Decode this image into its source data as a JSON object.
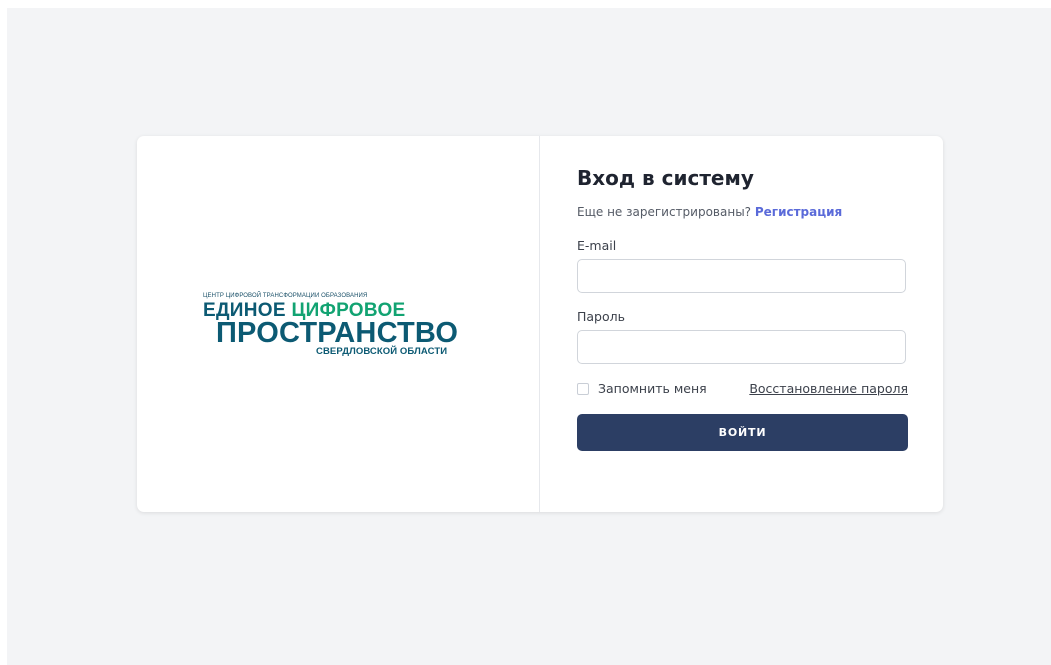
{
  "logo": {
    "top_text": "ЦЕНТР ЦИФРОВОЙ ТРАНСФОРМАЦИИ ОБРАЗОВАНИЯ",
    "line1_dark": "ЕДИНОЕ",
    "line1_green": "ЦИФРОВОЕ",
    "line2": "ПРОСТРАНСТВО",
    "line3": "СВЕРДЛОВСКОЙ ОБЛАСТИ",
    "colors": {
      "dark": "#0c5a73",
      "green": "#12a372"
    }
  },
  "login": {
    "title": "Вход в систему",
    "register_prompt": "Еще не зарегистрированы?",
    "register_link": "Регистрация",
    "email_label": "E-mail",
    "email_value": "",
    "password_label": "Пароль",
    "password_value": "",
    "remember_label": "Запомнить меня",
    "remember_checked": false,
    "restore_link": "Восстановление пароля",
    "submit_label": "ВОЙТИ"
  },
  "colors": {
    "background": "#f3f4f6",
    "button": "#2c3e64",
    "link_accent": "#5a6ad9"
  }
}
